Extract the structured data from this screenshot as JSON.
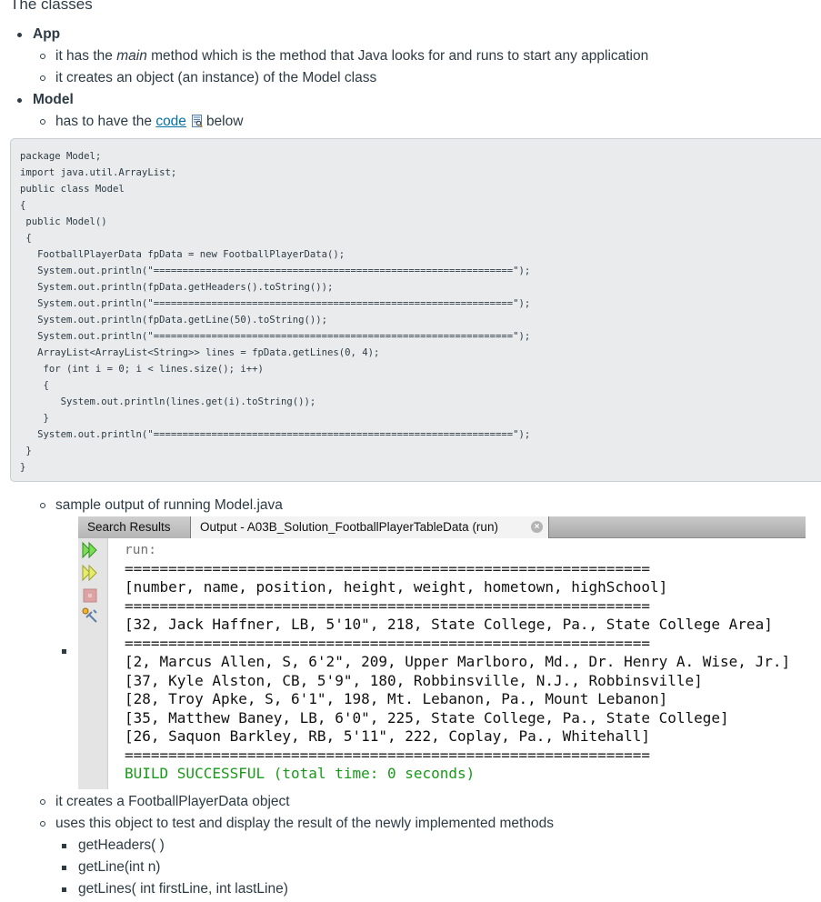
{
  "page": {
    "title": "The classes",
    "classes": [
      {
        "name": "App",
        "points": [
          {
            "before": "it has the ",
            "emphasis": "main",
            "after": " method which is the method that Java looks for and runs to start any application"
          },
          {
            "text": "it creates an object (an instance) of the Model class"
          }
        ]
      },
      {
        "name": "Model",
        "points": [
          {
            "before": "has to have the ",
            "link": "code",
            "icon": "document-preview-icon",
            "after": "below"
          }
        ]
      }
    ],
    "code": "package Model;\nimport java.util.ArrayList;\npublic class Model\n{\n public Model()\n {\n   FootballPlayerData fpData = new FootballPlayerData();\n   System.out.println(\"==============================================================\");\n   System.out.println(fpData.getHeaders().toString());\n   System.out.println(\"==============================================================\");\n   System.out.println(fpData.getLine(50).toString());\n   System.out.println(\"==============================================================\");\n   ArrayList<ArrayList<String>> lines = fpData.getLines(0, 4);\n    for (int i = 0; i < lines.size(); i++)\n    {\n       System.out.println(lines.get(i).toString());\n    }\n   System.out.println(\"==============================================================\");\n }\n}",
    "sample_output_label": "sample output of running Model.java",
    "ide": {
      "tabs": [
        "Search Results",
        "Output - A03B_Solution_FootballPlayerTableData (run)"
      ],
      "gutter_icons": [
        "run-again-icon",
        "run-icon",
        "stop-icon",
        "settings-icon"
      ],
      "console": {
        "run": "run:",
        "separator": "============================================================",
        "headers": "[number, name, position, height, weight, hometown, highSchool]",
        "line50": "[32, Jack Haffner, LB, 5'10\", 218, State College, Pa., State College Area]",
        "lines": [
          "[2, Marcus Allen, S, 6'2\", 209, Upper Marlboro, Md., Dr. Henry A. Wise, Jr.]",
          "[37, Kyle Alston, CB, 5'9\", 180, Robbinsville, N.J., Robbinsville]",
          "[28, Troy Apke, S, 6'1\", 198, Mt. Lebanon, Pa., Mount Lebanon]",
          "[35, Matthew Baney, LB, 6'0\", 225, State College, Pa., State College]",
          "[26, Saquon Barkley, RB, 5'11\", 222, Coplay, Pa., Whitehall]"
        ],
        "build": "BUILD SUCCESSFUL (total time: 0 seconds)"
      }
    },
    "after_points": [
      "it creates a FootballPlayerData object",
      "uses this object to test and display the result of the newly implemented methods"
    ],
    "methods": [
      "getHeaders( )",
      "getLine(int n)",
      "getLines( int firstLine, int lastLine)"
    ]
  }
}
